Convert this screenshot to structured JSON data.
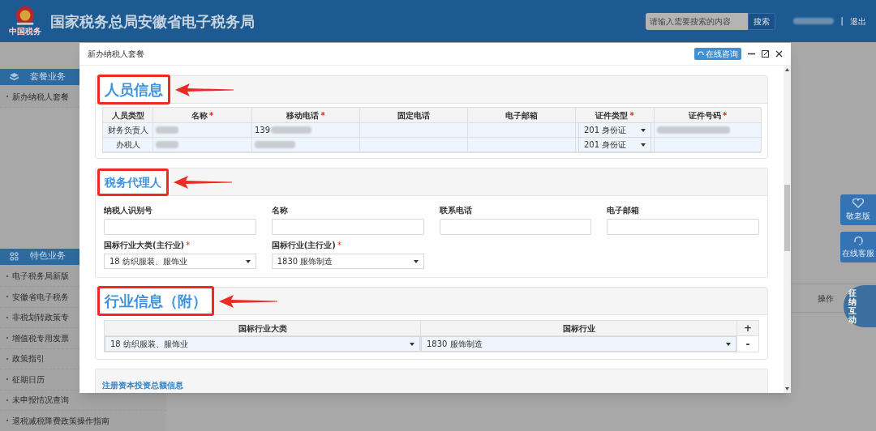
{
  "header": {
    "site_title": "国家税务总局安徽省电子税务局",
    "logo_text": "中国税务",
    "search": {
      "placeholder": "请输入需要搜索的内容",
      "button": "搜索"
    },
    "separator": "|",
    "logout": "退出"
  },
  "sidebar": [
    {
      "title": "套餐业务",
      "items": [
        "新办纳税人套餐"
      ]
    },
    {
      "title": "特色业务",
      "items": [
        "电子税务局新版",
        "安徽省电子税务",
        "非税划转政策专",
        "增值税专用发票",
        "政策指引",
        "征期日历",
        "未申报情况查询",
        "退税减税降费政策操作指南"
      ]
    }
  ],
  "background_table": {
    "columns": [
      "操作"
    ]
  },
  "float_buttons": [
    {
      "label": "敬老版"
    },
    {
      "label": "在线客服"
    }
  ],
  "mascot": {
    "text": "征纳互动"
  },
  "modal": {
    "title": "新办纳税人套餐",
    "consult_button": "在线咨询",
    "sections": [
      {
        "kind": "table",
        "title": "人员信息",
        "highlighted": true,
        "columns": [
          {
            "label": "人员类型"
          },
          {
            "label": "名称",
            "required_mark": "*"
          },
          {
            "label": "移动电话",
            "required_mark": "*"
          },
          {
            "label": "固定电话"
          },
          {
            "label": "电子邮箱"
          },
          {
            "label": "证件类型",
            "required_mark": "*"
          },
          {
            "label": "证件号码",
            "required_mark": "*"
          }
        ],
        "rows": [
          [
            {
              "text": "财务负责人"
            },
            {
              "redacted": true
            },
            {
              "text": "139",
              "redacted": true
            },
            {},
            {},
            {
              "select": "201 身份证"
            },
            {
              "redacted": true
            }
          ],
          [
            {
              "text": "办税人"
            },
            {
              "redacted": true
            },
            {
              "redacted": true
            },
            {},
            {},
            {
              "select": "201 身份证"
            },
            {}
          ]
        ]
      },
      {
        "kind": "form",
        "title": "税务代理人",
        "highlighted": true,
        "fields": [
          {
            "label": "纳税人识别号"
          },
          {
            "label": "名称"
          },
          {
            "label": "联系电话"
          },
          {
            "label": "电子邮箱"
          },
          {
            "label": "国标行业大类(主行业)",
            "required_mark": "*",
            "select": "18 纺织服装、服饰业"
          },
          {
            "label": "国标行业(主行业)",
            "required_mark": "*",
            "select": "1830 服饰制造"
          }
        ]
      },
      {
        "kind": "industry",
        "title": "行业信息（附）",
        "highlighted": true,
        "columns": [
          "国标行业大类",
          "国标行业"
        ],
        "add": "+",
        "rows": [
          {
            "values": [
              "18 纺织服装、服饰业",
              "1830 服饰制造"
            ],
            "remove": "-"
          }
        ]
      },
      {
        "kind": "collapsed",
        "title": "注册资本投资总额信息",
        "highlighted": false
      }
    ]
  }
}
